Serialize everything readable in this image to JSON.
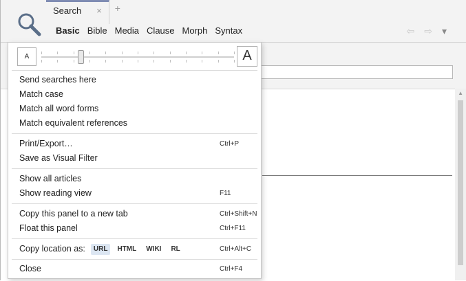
{
  "tab": {
    "label": "Search",
    "close_glyph": "×",
    "add_glyph": "+"
  },
  "search_types": [
    "Basic",
    "Bible",
    "Media",
    "Clause",
    "Morph",
    "Syntax"
  ],
  "active_search_type": "Basic",
  "nav": {
    "back_glyph": "⇦",
    "forward_glyph": "⇨",
    "menu_glyph": "▾"
  },
  "zoom": {
    "small_label": "A",
    "large_label": "A",
    "level": 0.2
  },
  "menu": {
    "group1": [
      "Send searches here",
      "Match case",
      "Match all word forms",
      "Match equivalent references"
    ],
    "print_export": {
      "label": "Print/Export…",
      "shortcut": "Ctrl+P"
    },
    "save_visual_filter": {
      "label": "Save as Visual Filter"
    },
    "show_all_articles": {
      "label": "Show all articles"
    },
    "show_reading_view": {
      "label": "Show reading view",
      "shortcut": "F11"
    },
    "copy_panel": {
      "label": "Copy this panel to a new tab",
      "shortcut": "Ctrl+Shift+N"
    },
    "float_panel": {
      "label": "Float this panel",
      "shortcut": "Ctrl+F11"
    },
    "copy_location": {
      "label": "Copy location as:",
      "formats": [
        "URL",
        "HTML",
        "WIKI",
        "RL"
      ],
      "selected": "URL",
      "shortcut": "Ctrl+Alt+C"
    },
    "close": {
      "label": "Close",
      "shortcut": "Ctrl+F4"
    }
  },
  "colors": {
    "accent": "#7f8cb3",
    "selected_format_bg": "#dce6f2"
  }
}
